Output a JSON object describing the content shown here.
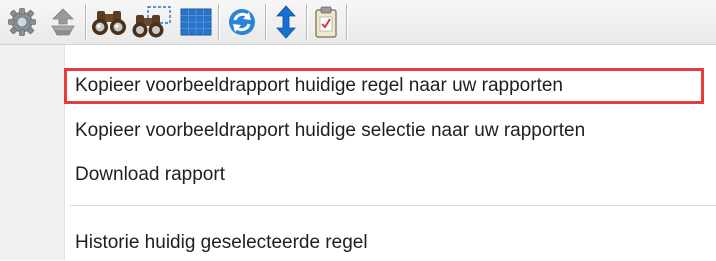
{
  "toolbar": {
    "buttons": [
      {
        "icon": "gear-icon"
      },
      {
        "icon": "stack-up-icon"
      },
      {
        "icon": "binoculars-icon"
      },
      {
        "icon": "binoculars-selection-icon"
      },
      {
        "icon": "grid-icon"
      },
      {
        "icon": "refresh-icon"
      },
      {
        "icon": "vertical-arrows-icon"
      },
      {
        "icon": "clipboard-check-icon"
      }
    ]
  },
  "menu": {
    "items": [
      {
        "label": "Kopieer voorbeeldrapport huidige regel naar uw rapporten",
        "highlighted": true
      },
      {
        "label": "Kopieer voorbeeldrapport huidige selectie naar uw rapporten"
      },
      {
        "label": "Download rapport"
      },
      {
        "label": "Historie huidig geselecteerde regel"
      }
    ]
  },
  "colors": {
    "highlight_border": "#e43d3d",
    "grid_icon": "#2a73c9",
    "arrow_icon": "#1b6fcf"
  }
}
